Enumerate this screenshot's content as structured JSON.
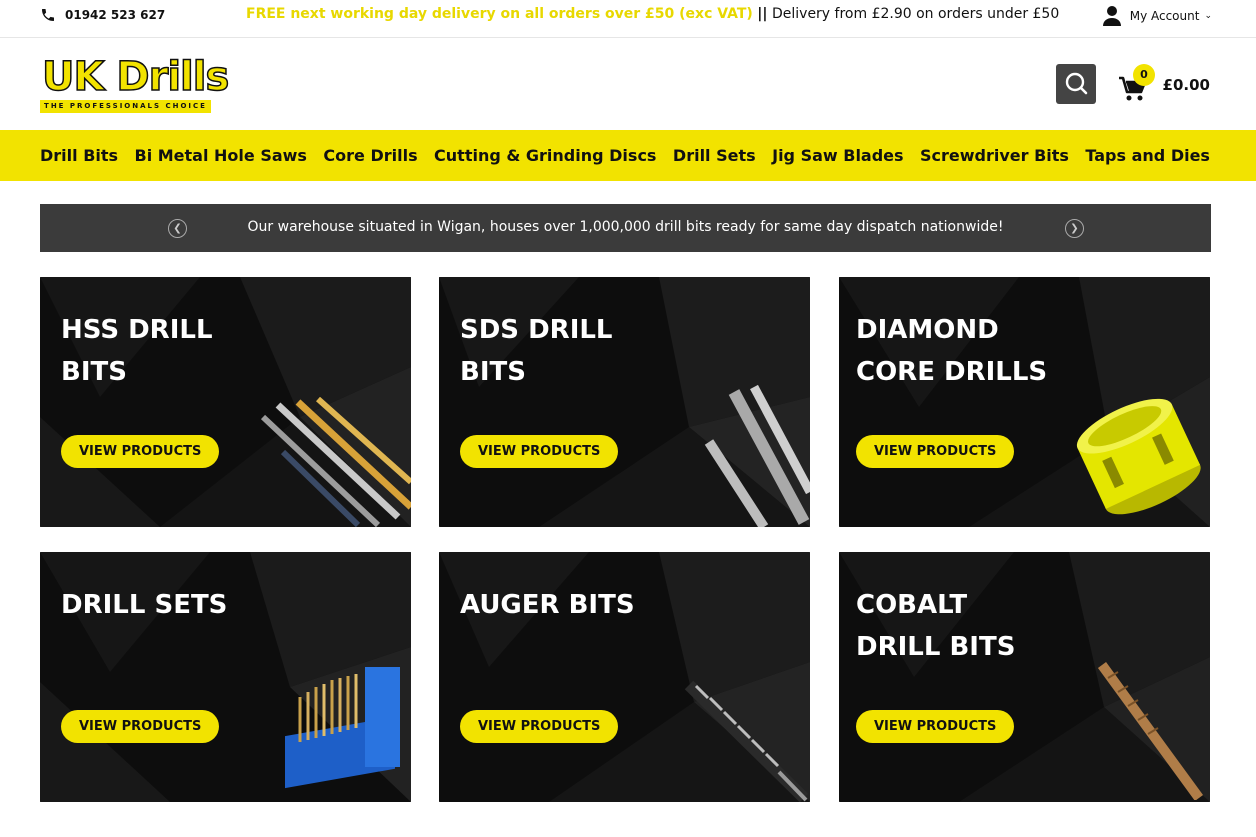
{
  "topbar": {
    "phone": "01942 523 627",
    "promo_highlight": "FREE next working day delivery on all orders over £50 (exc VAT)",
    "promo_separator": "||",
    "promo_rest": "Delivery from £2.90 on orders under £50",
    "account_label": "My Account"
  },
  "header": {
    "logo_text": "UK Drills",
    "logo_tagline": "THE PROFESSIONALS CHOICE",
    "cart_count": "0",
    "cart_total": "£0.00"
  },
  "nav": {
    "items": [
      {
        "label": "Drill Bits"
      },
      {
        "label": "Bi Metal Hole Saws"
      },
      {
        "label": "Core Drills"
      },
      {
        "label": "Cutting & Grinding Discs"
      },
      {
        "label": "Drill Sets"
      },
      {
        "label": "Jig Saw Blades"
      },
      {
        "label": "Screwdriver Bits"
      },
      {
        "label": "Taps and Dies"
      }
    ]
  },
  "banner": {
    "text": "Our warehouse situated in Wigan, houses over 1,000,000 drill bits ready for same day dispatch nationwide!"
  },
  "cards": [
    {
      "line1": "HSS DRILL",
      "line2": "BITS",
      "button": "VIEW PRODUCTS"
    },
    {
      "line1": "SDS DRILL",
      "line2": "BITS",
      "button": "VIEW PRODUCTS"
    },
    {
      "line1": "DIAMOND",
      "line2": "CORE DRILLS",
      "button": "VIEW PRODUCTS"
    },
    {
      "line1": "DRILL SETS",
      "line2": "",
      "button": "VIEW PRODUCTS"
    },
    {
      "line1": "AUGER BITS",
      "line2": "",
      "button": "VIEW PRODUCTS"
    },
    {
      "line1": "COBALT",
      "line2": "DRILL BITS",
      "button": "VIEW PRODUCTS"
    }
  ],
  "colors": {
    "brand_yellow": "#f2e300",
    "card_bg": "#0e0e0e",
    "banner_bg": "#3b3b3b"
  },
  "icons": [
    "phone-icon",
    "user-icon",
    "search-icon",
    "cart-icon",
    "chevron-left-icon",
    "chevron-right-icon"
  ]
}
